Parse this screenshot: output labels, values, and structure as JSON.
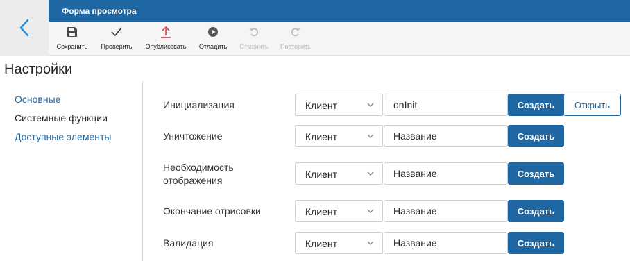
{
  "header": {
    "title": "Форма просмотра",
    "back_icon": "chevron-left-icon"
  },
  "toolbar": {
    "items": [
      {
        "label": "Сохранить",
        "icon": "save-icon",
        "enabled": true
      },
      {
        "label": "Проверить",
        "icon": "check-icon",
        "enabled": true
      },
      {
        "label": "Опубликовать",
        "icon": "publish-icon",
        "enabled": true
      },
      {
        "label": "Отладить",
        "icon": "play-icon",
        "enabled": true
      },
      {
        "label": "Отменить",
        "icon": "undo-icon",
        "enabled": false
      },
      {
        "label": "Повторить",
        "icon": "redo-icon",
        "enabled": false
      }
    ]
  },
  "page": {
    "title": "Настройки"
  },
  "sidebar": {
    "items": [
      {
        "label": "Основные",
        "active": false
      },
      {
        "label": "Системные функции",
        "active": true
      },
      {
        "label": "Доступные элементы",
        "active": false
      }
    ]
  },
  "functions": {
    "rows": [
      {
        "label": "Инициализация",
        "select_value": "Клиент",
        "input_value": "onInit",
        "input_placeholder": "Название",
        "create_label": "Создать",
        "open_label": "Открыть"
      },
      {
        "label": "Уничтожение",
        "select_value": "Клиент",
        "input_value": "",
        "input_placeholder": "Название",
        "create_label": "Создать"
      },
      {
        "label": "Необходимость отображения",
        "select_value": "Клиент",
        "input_value": "",
        "input_placeholder": "Название",
        "create_label": "Создать"
      },
      {
        "label": "Окончание отрисовки",
        "select_value": "Клиент",
        "input_value": "",
        "input_placeholder": "Название",
        "create_label": "Создать"
      },
      {
        "label": "Валидация",
        "select_value": "Клиент",
        "input_value": "",
        "input_placeholder": "Название",
        "create_label": "Создать"
      }
    ]
  },
  "colors": {
    "accent": "#1f67a3",
    "disabled": "#b9b9b9",
    "publish": "#d9343b"
  }
}
